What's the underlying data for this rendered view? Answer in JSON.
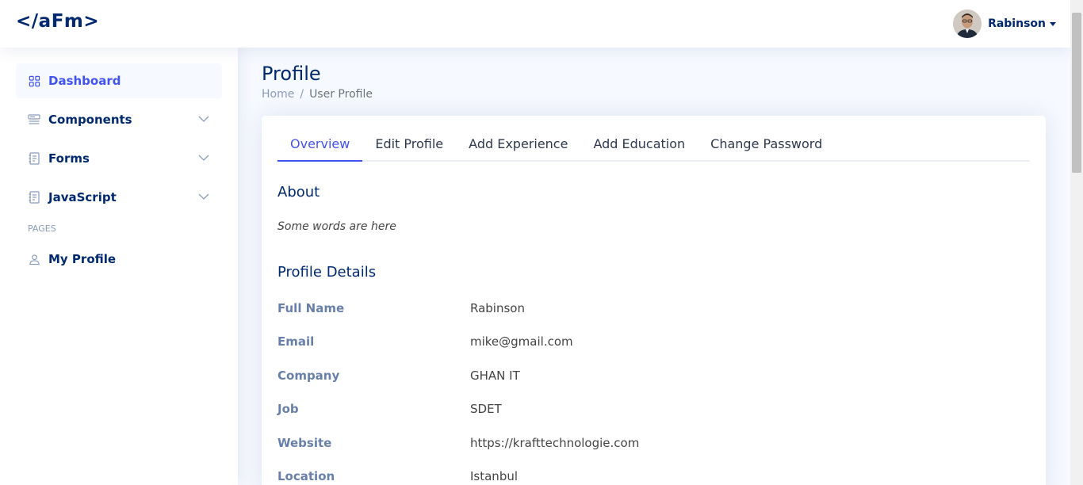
{
  "header": {
    "logo": "</aFm>",
    "user_name": "Rabinson"
  },
  "sidebar": {
    "items": [
      {
        "label": "Dashboard",
        "icon": "grid-icon",
        "active": true
      },
      {
        "label": "Components",
        "icon": "menu-button-icon"
      },
      {
        "label": "Forms",
        "icon": "journal-text-icon"
      },
      {
        "label": "JavaScript",
        "icon": "journal-text-icon"
      }
    ],
    "pages_heading": "Pages",
    "profile_label": "My Profile"
  },
  "page": {
    "title": "Profile",
    "breadcrumb": [
      "Home",
      "User Profile"
    ]
  },
  "tabs": [
    "Overview",
    "Edit Profile",
    "Add Experience",
    "Add Education",
    "Change Password"
  ],
  "overview": {
    "about_title": "About",
    "about_text": "Some words are here",
    "details_title": "Profile Details",
    "details": [
      {
        "label": "Full Name",
        "value": "Rabinson"
      },
      {
        "label": "Email",
        "value": "mike@gmail.com"
      },
      {
        "label": "Company",
        "value": "GHAN IT"
      },
      {
        "label": "Job",
        "value": "SDET"
      },
      {
        "label": "Website",
        "value": "https://krafttechnologie.com"
      },
      {
        "label": "Location",
        "value": "Istanbul"
      }
    ]
  },
  "colors": {
    "primary": "#4154f1",
    "navy": "#012970",
    "muted": "#899bbd",
    "background": "#f6f9ff"
  }
}
